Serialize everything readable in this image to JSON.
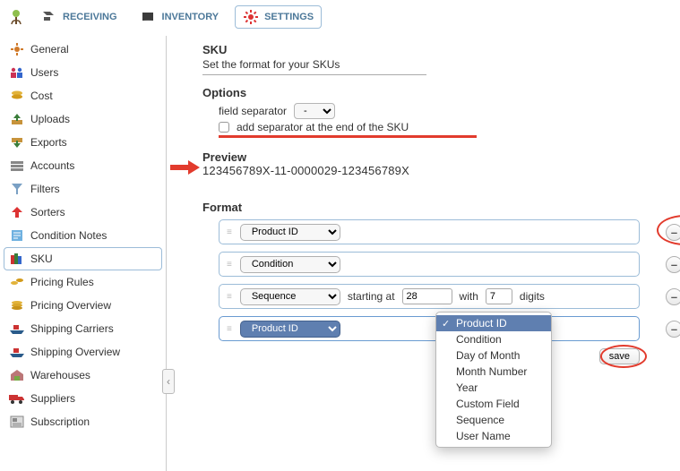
{
  "topnav": {
    "items": [
      {
        "label": "RECEIVING"
      },
      {
        "label": "INVENTORY"
      },
      {
        "label": "SETTINGS"
      }
    ]
  },
  "sidebar": {
    "items": [
      {
        "label": "General"
      },
      {
        "label": "Users"
      },
      {
        "label": "Cost"
      },
      {
        "label": "Uploads"
      },
      {
        "label": "Exports"
      },
      {
        "label": "Accounts"
      },
      {
        "label": "Filters"
      },
      {
        "label": "Sorters"
      },
      {
        "label": "Condition Notes"
      },
      {
        "label": "SKU"
      },
      {
        "label": "Pricing Rules"
      },
      {
        "label": "Pricing Overview"
      },
      {
        "label": "Shipping Carriers"
      },
      {
        "label": "Shipping Overview"
      },
      {
        "label": "Warehouses"
      },
      {
        "label": "Suppliers"
      },
      {
        "label": "Subscription"
      }
    ]
  },
  "sku": {
    "title": "SKU",
    "description": "Set the format for your SKUs",
    "options_title": "Options",
    "field_separator_label": "field separator",
    "field_separator_value": "-",
    "add_sep_label": "add separator at the end of the SKU",
    "preview_title": "Preview",
    "preview_value": "123456789X-11-0000029-123456789X",
    "format_title": "Format",
    "rows": [
      {
        "field": "Product ID"
      },
      {
        "field": "Condition"
      },
      {
        "field": "Sequence",
        "starting_at_label": "starting at",
        "starting_at": "28",
        "with_label": "with",
        "digits": "7",
        "digits_label": "digits"
      },
      {
        "field": "Product ID"
      }
    ],
    "minus": "–",
    "plus": "+",
    "save_label": "save"
  },
  "dropdown": {
    "options": [
      "Product ID",
      "Condition",
      "Day of Month",
      "Month Number",
      "Year",
      "Custom Field",
      "Sequence",
      "User Name"
    ]
  }
}
